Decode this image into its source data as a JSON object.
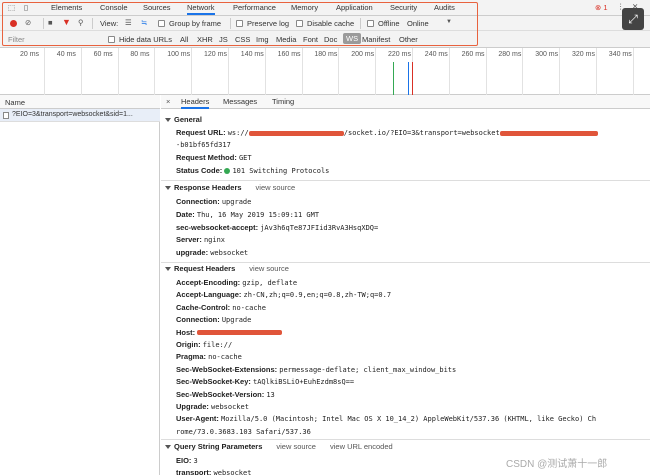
{
  "devtools": {
    "tabs": [
      "Elements",
      "Console",
      "Sources",
      "Network",
      "Performance",
      "Memory",
      "Application",
      "Security",
      "Audits"
    ],
    "active_tab": "Network",
    "error_count": "1",
    "more": "⋮",
    "close": "✕"
  },
  "toolbar": {
    "view_label": "View:",
    "group_by_frame": "Group by frame",
    "preserve_log": "Preserve log",
    "disable_cache": "Disable cache",
    "offline": "Offline",
    "online": "Online"
  },
  "filterbar": {
    "placeholder": "Filter",
    "hide_data_urls": "Hide data URLs",
    "types": [
      "All",
      "XHR",
      "JS",
      "CSS",
      "Img",
      "Media",
      "Font",
      "Doc",
      "WS",
      "Manifest",
      "Other"
    ],
    "active_type": "WS"
  },
  "timeline": {
    "ticks": [
      "20 ms",
      "40 ms",
      "60 ms",
      "80 ms",
      "100 ms",
      "120 ms",
      "140 ms",
      "160 ms",
      "180 ms",
      "200 ms",
      "220 ms",
      "240 ms",
      "260 ms",
      "280 ms",
      "300 ms",
      "320 ms",
      "340 ms"
    ]
  },
  "requests": {
    "header": "Name",
    "items": [
      "?EIO=3&transport=websocket&sid=1..."
    ]
  },
  "detail": {
    "close": "×",
    "tabs": [
      "Headers",
      "Messages",
      "Timing"
    ],
    "active_tab": "Headers",
    "general": {
      "title": "General",
      "request_url_key": "Request URL:",
      "request_url_prefix": "ws://",
      "request_url_mid": "/socket.io/?EIO=3&transport=websocket",
      "request_url_line2": "-b01bf65fd317",
      "request_method_key": "Request Method:",
      "request_method": "GET",
      "status_code_key": "Status Code:",
      "status_code": "101 Switching Protocols"
    },
    "response_headers": {
      "title": "Response Headers",
      "view_source": "view source",
      "rows": [
        {
          "k": "Connection:",
          "v": "upgrade"
        },
        {
          "k": "Date:",
          "v": "Thu, 16 May 2019 15:09:11 GMT"
        },
        {
          "k": "sec-websocket-accept:",
          "v": "jAv3h6qTe87JFIid3RvA3HsqXDQ="
        },
        {
          "k": "Server:",
          "v": "nginx"
        },
        {
          "k": "upgrade:",
          "v": "websocket"
        }
      ]
    },
    "request_headers": {
      "title": "Request Headers",
      "view_source": "view source",
      "rows": [
        {
          "k": "Accept-Encoding:",
          "v": "gzip, deflate"
        },
        {
          "k": "Accept-Language:",
          "v": "zh-CN,zh;q=0.9,en;q=0.8,zh-TW;q=0.7"
        },
        {
          "k": "Cache-Control:",
          "v": "no-cache"
        },
        {
          "k": "Connection:",
          "v": "Upgrade"
        },
        {
          "k": "Host:",
          "v": ""
        },
        {
          "k": "Origin:",
          "v": "file://"
        },
        {
          "k": "Pragma:",
          "v": "no-cache"
        },
        {
          "k": "Sec-WebSocket-Extensions:",
          "v": "permessage-deflate; client_max_window_bits"
        },
        {
          "k": "Sec-WebSocket-Key:",
          "v": "tAQlkiBSLiO+EuhEzdm8sQ=="
        },
        {
          "k": "Sec-WebSocket-Version:",
          "v": "13"
        },
        {
          "k": "Upgrade:",
          "v": "websocket"
        },
        {
          "k": "User-Agent:",
          "v": "Mozilla/5.0 (Macintosh; Intel Mac OS X 10_14_2) AppleWebKit/537.36 (KHTML, like Gecko) Ch"
        }
      ],
      "user_agent_line2": "rome/73.0.3683.103 Safari/537.36"
    },
    "query_string": {
      "title": "Query String Parameters",
      "view_source": "view source",
      "view_url_encoded": "view URL encoded",
      "rows": [
        {
          "k": "EIO:",
          "v": "3"
        },
        {
          "k": "transport:",
          "v": "websocket"
        }
      ]
    }
  },
  "watermark": "CSDN @测试萧十一郎",
  "colors": {
    "accent": "#1a73e8",
    "highlight_box": "#e8623e",
    "record": "#d93025",
    "status_ok": "#34a853",
    "redaction": "#e0553a"
  }
}
